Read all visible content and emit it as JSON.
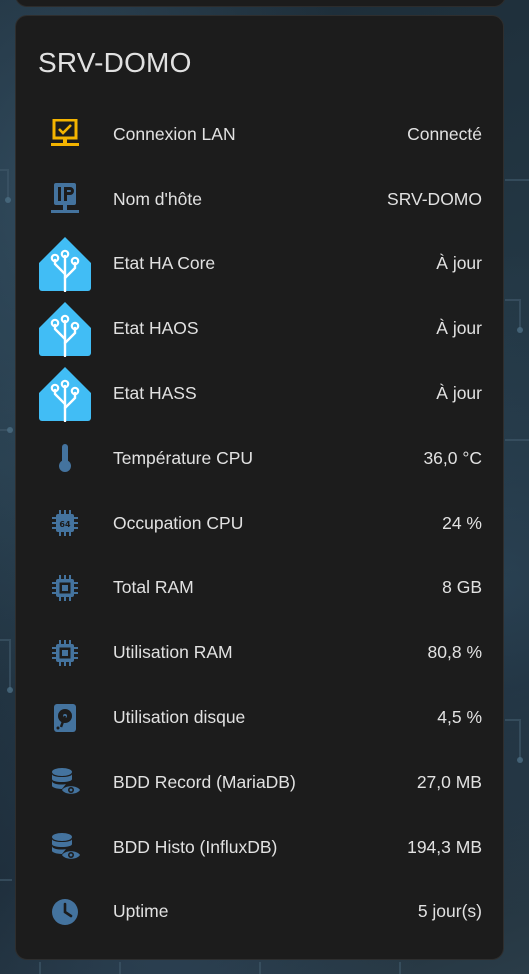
{
  "card": {
    "title": "SRV-DOMO",
    "rows": [
      {
        "icon": "lan-connect-icon",
        "label": "Connexion LAN",
        "value": "Connecté",
        "icon_color": "#f4b400"
      },
      {
        "icon": "ip-network-icon",
        "label": "Nom d'hôte",
        "value": "SRV-DOMO",
        "icon_color": "#44739e"
      },
      {
        "icon": "home-assistant-logo-icon",
        "label": "Etat HA Core",
        "value": "À jour",
        "icon_color": "#41bdf5"
      },
      {
        "icon": "home-assistant-logo-icon",
        "label": "Etat HAOS",
        "value": "À jour",
        "icon_color": "#41bdf5"
      },
      {
        "icon": "home-assistant-logo-icon",
        "label": "Etat HASS",
        "value": "À jour",
        "icon_color": "#41bdf5"
      },
      {
        "icon": "thermometer-icon",
        "label": "Température CPU",
        "value": "36,0 °C",
        "icon_color": "#44739e"
      },
      {
        "icon": "cpu-64-icon",
        "label": "Occupation CPU",
        "value": "24 %",
        "icon_color": "#44739e"
      },
      {
        "icon": "memory-chip-icon",
        "label": "Total RAM",
        "value": "8 GB",
        "icon_color": "#44739e"
      },
      {
        "icon": "memory-chip-icon",
        "label": "Utilisation RAM",
        "value": "80,8 %",
        "icon_color": "#44739e"
      },
      {
        "icon": "harddisk-icon",
        "label": "Utilisation disque",
        "value": "4,5 %",
        "icon_color": "#44739e"
      },
      {
        "icon": "database-eye-icon",
        "label": "BDD Record (MariaDB)",
        "value": "27,0 MB",
        "icon_color": "#44739e"
      },
      {
        "icon": "database-eye-icon",
        "label": "BDD Histo (InfluxDB)",
        "value": "194,3 MB",
        "icon_color": "#44739e"
      },
      {
        "icon": "clock-icon",
        "label": "Uptime",
        "value": "5 jour(s)",
        "icon_color": "#44739e"
      }
    ]
  }
}
